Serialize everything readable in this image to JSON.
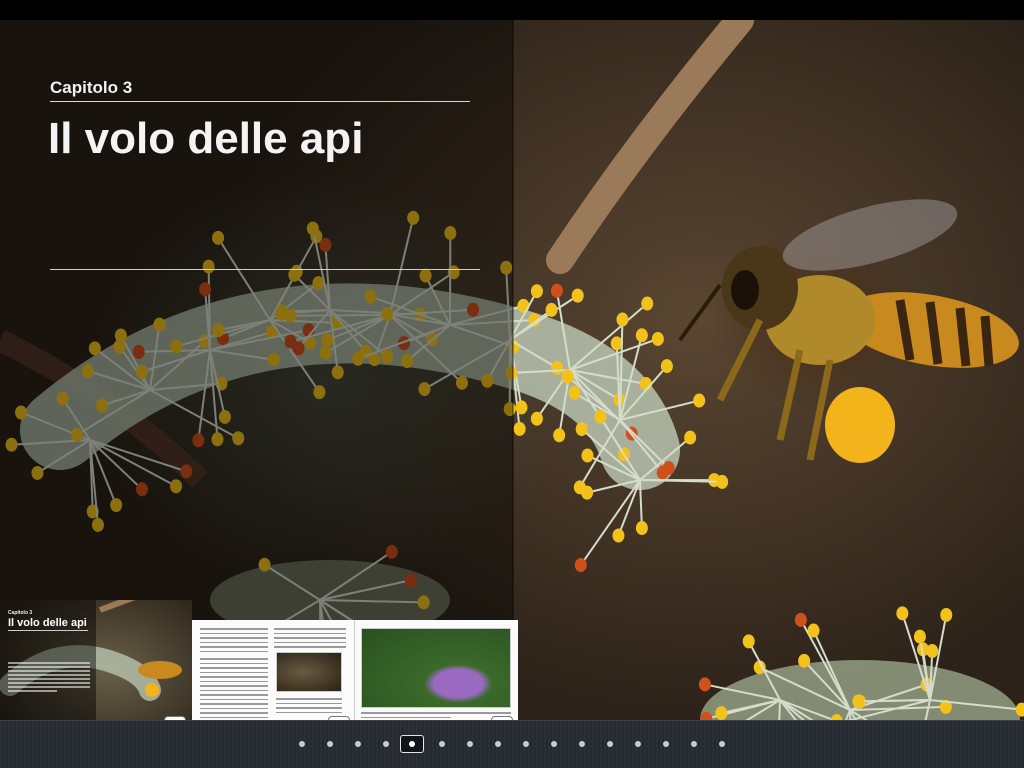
{
  "chapter": {
    "label": "Capitolo 3",
    "title": "Il volo delle api"
  },
  "thumbnails": [
    {
      "page": "19",
      "caption": "Capitolo 3",
      "title": "Il volo delle api"
    },
    {
      "page": "20"
    },
    {
      "page": "21"
    }
  ],
  "pagination": {
    "total_dots": 16,
    "current_index": 4
  },
  "colors": {
    "nav_background": "#2b2f36",
    "pollen_yellow": "#f2c21a",
    "bee_body": "#c88a1e"
  },
  "icons": [
    "page-dot",
    "current-page-indicator"
  ]
}
